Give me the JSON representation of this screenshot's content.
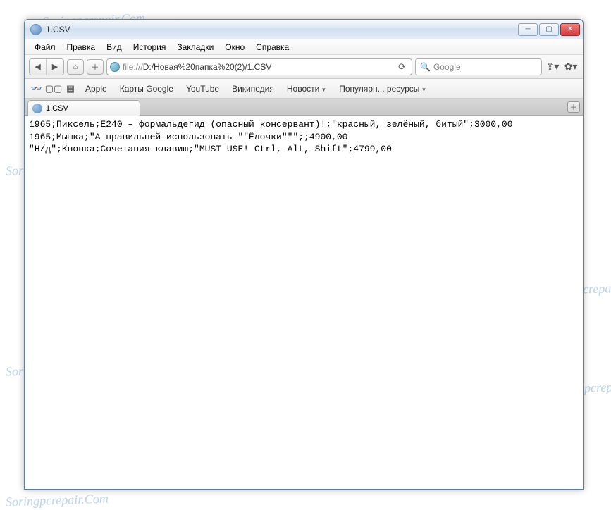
{
  "window": {
    "title": "1.CSV"
  },
  "menu": {
    "items": [
      "Файл",
      "Правка",
      "Вид",
      "История",
      "Закладки",
      "Окно",
      "Справка"
    ]
  },
  "nav": {
    "url_prefix": "file:///",
    "url_path": "D:/Новая%20папка%20(2)/1.CSV",
    "search_placeholder": "Google"
  },
  "bookmarks": {
    "items": [
      {
        "label": "Apple",
        "dropdown": false
      },
      {
        "label": "Карты Google",
        "dropdown": false
      },
      {
        "label": "YouTube",
        "dropdown": false
      },
      {
        "label": "Википедия",
        "dropdown": false
      },
      {
        "label": "Новости",
        "dropdown": true
      },
      {
        "label": "Популярн... ресурсы",
        "dropdown": true
      }
    ]
  },
  "tab": {
    "label": "1.CSV"
  },
  "content": {
    "lines": [
      "1965;Пиксель;E240 – формальдегид (опасный консервант)!;\"красный, зелёный, битый\";3000,00",
      "1965;Мышка;\"А правильней использовать \"\"Ёлочки\"\"\";;4900,00",
      "\"Н/д\";Кнопка;Сочетания клавиш;\"MUST USE! Ctrl, Alt, Shift\";4799,00"
    ]
  },
  "watermark_text": "Soringpcrepair.Com"
}
